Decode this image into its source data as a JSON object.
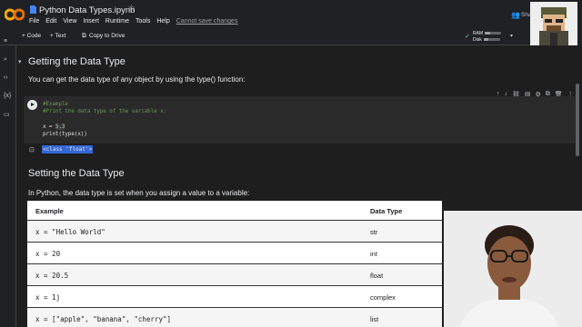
{
  "window": {
    "title": "Python Data Types.ipynb",
    "menu": [
      "File",
      "Edit",
      "View",
      "Insert",
      "Runtime",
      "Tools",
      "Help"
    ],
    "unsaved": "Cannot save changes",
    "share": "Sha"
  },
  "toolbar": {
    "code_label": "+ Code",
    "text_label": "+ Text",
    "copy_label": "Copy to Drive",
    "ram_label": "RAM",
    "disk_label": "Disk",
    "ram_level": 0.35,
    "disk_level": 0.3
  },
  "section1": {
    "title": "Getting the Data Type",
    "desc": "You can get the data type of any object by using the type() function:"
  },
  "code": {
    "line1": "#Example",
    "line2": "#Print the data type of the variable x:",
    "line3_prefix": "x = ",
    "line3_value": "5.3",
    "line4": "print(type(x))"
  },
  "output": {
    "text": "<class 'float'>"
  },
  "section2": {
    "title": "Setting the Data Type",
    "desc": "In Python, the data type is set when you assign a value to a variable:"
  },
  "table": {
    "headers": [
      "Example",
      "Data Type"
    ],
    "rows": [
      [
        "x = \"Hello World\"",
        "str"
      ],
      [
        "x = 20",
        "int"
      ],
      [
        "x = 20.5",
        "float"
      ],
      [
        "x = 1j",
        "complex"
      ],
      [
        "x = [\"apple\", \"banana\", \"cherry\"]",
        "list"
      ]
    ]
  },
  "colors": {
    "accent": "#f9ab00",
    "background": "#202124",
    "selection": "#3367d6"
  }
}
